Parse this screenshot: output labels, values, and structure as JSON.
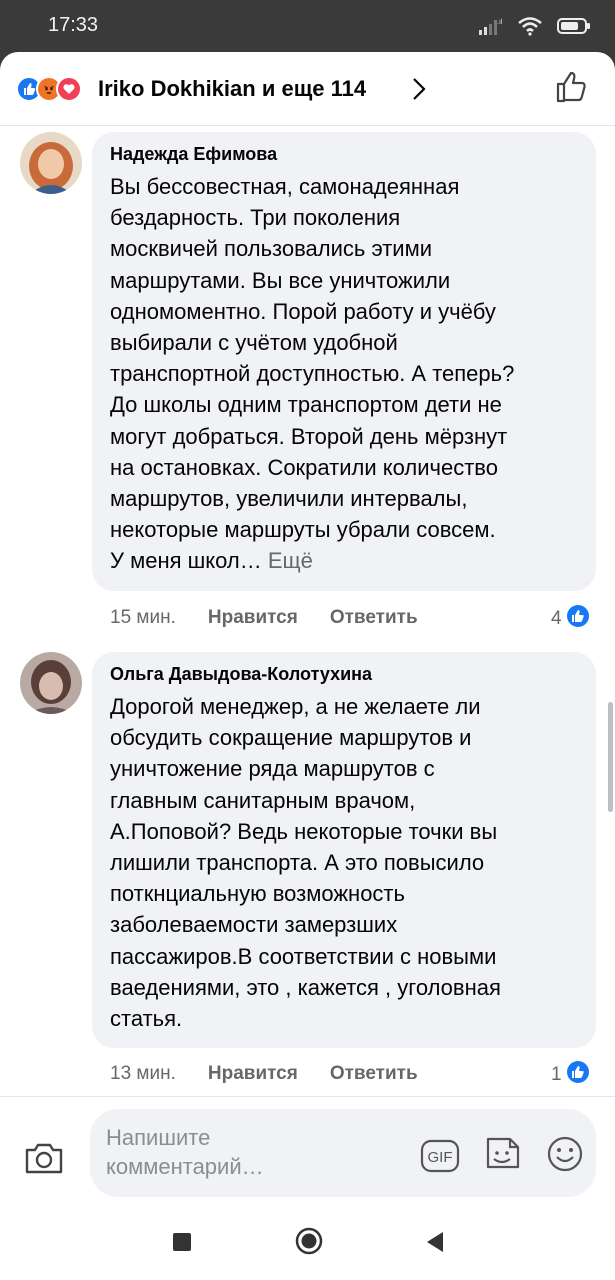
{
  "status_bar": {
    "time": "17:33",
    "battery": "79"
  },
  "header": {
    "reactors": "Iriko Dokhikian и еще 114"
  },
  "comments": [
    {
      "author": "Надежда Ефимова",
      "text": "Вы бессовестная, самонадеянная\nбездарность. Три поколения\nмосквичей пользовались этими\nмаршрутами. Вы все уничтожили\nодномоментно. Порой работу и учёбу\nвыбирали с учётом удобной\nтранспортной доступностью. А теперь?\nДо школы одним транспортом дети не\nмогут добраться. Второй день мёрзнут\nна остановках. Сократили количество\nмаршрутов, увеличили интервалы,\nнекоторые маршруты убрали совсем.\nУ меня школ…",
      "more": "Ещё",
      "time": "15 мин.",
      "like": "Нравится",
      "reply": "Ответить",
      "likes": "4"
    },
    {
      "author": "Ольга Давыдова-Колотухина",
      "text": "Дорогой менеджер, а не желаете ли\nобсудить сокращение маршрутов и\nуничтожение ряда маршрутов с\nглавным санитарным врачом,\nА.Поповой? Ведь некоторые точки вы\nлишили транспорта. А это повысило\nпоткнциальную возможность\nзаболеваемости замерзших\nпассажиров.В соответствии с новыми\nваедениями, это , кажется , уголовная\nстатья.",
      "time": "13 мин.",
      "like": "Нравится",
      "reply": "Ответить",
      "likes": "1"
    }
  ],
  "composer": {
    "placeholder": "Напишите комментарий…"
  },
  "colors": {
    "accent": "#1877f2",
    "bubble": "#f0f2f5",
    "meta": "#65676b"
  }
}
